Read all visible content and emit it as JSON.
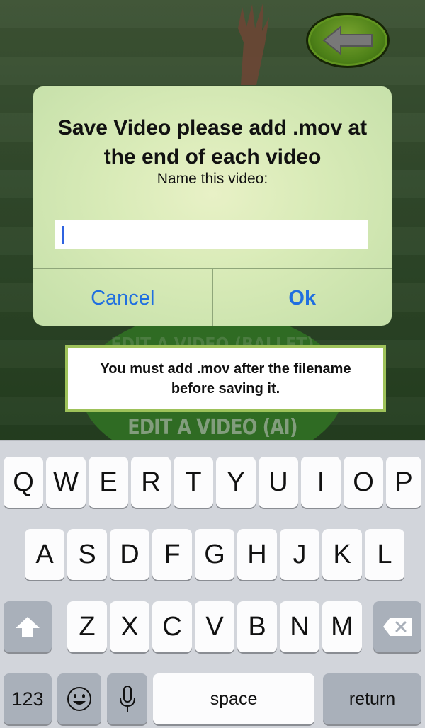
{
  "alert": {
    "title": "Save Video please add .mov at the end of each video",
    "message": "Name this video:",
    "input_value": "",
    "cancel_label": "Cancel",
    "ok_label": "Ok"
  },
  "toast": {
    "text": "You must add .mov after the filename before saving it."
  },
  "background": {
    "menu_label": "EDIT A VIDEO (AI)",
    "menu_label_faint": "EDIT A VIDEO (BALLET)",
    "back_icon": "back-arrow-icon"
  },
  "keyboard": {
    "row1": [
      "Q",
      "W",
      "E",
      "R",
      "T",
      "Y",
      "U",
      "I",
      "O",
      "P"
    ],
    "row2": [
      "A",
      "S",
      "D",
      "F",
      "G",
      "H",
      "J",
      "K",
      "L"
    ],
    "row3": [
      "Z",
      "X",
      "C",
      "V",
      "B",
      "N",
      "M"
    ],
    "numbers_label": "123",
    "space_label": "space",
    "return_label": "return"
  },
  "colors": {
    "accent": "#1f6fe0",
    "toast_border": "#9ec25a",
    "back_button": "#63a51f"
  }
}
